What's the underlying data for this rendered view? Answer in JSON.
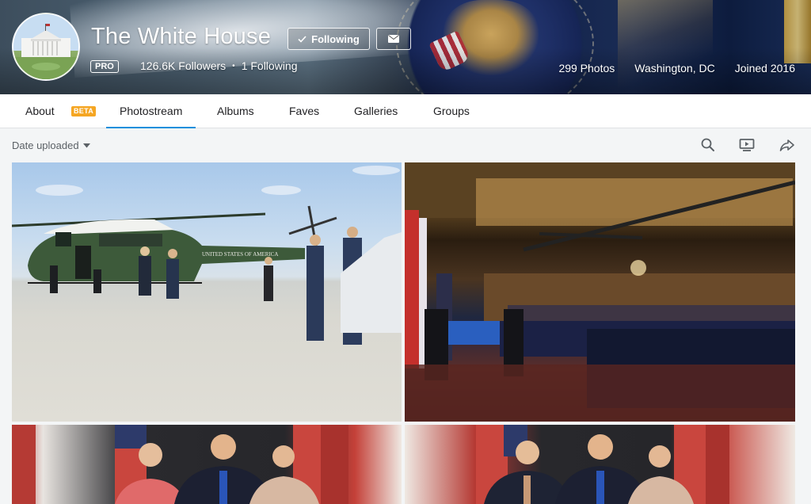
{
  "profile": {
    "name": "The White House",
    "follow_label": "Following",
    "pro_label": "PRO",
    "followers": "126.6K Followers",
    "following": "1 Following",
    "photos": "299 Photos",
    "location": "Washington, DC",
    "joined": "Joined 2016"
  },
  "tabs": {
    "about": "About",
    "beta": "BETA",
    "photostream": "Photostream",
    "albums": "Albums",
    "faves": "Faves",
    "galleries": "Galleries",
    "groups": "Groups",
    "active": "Photostream"
  },
  "toolbar": {
    "sort_label": "Date uploaded",
    "icons": [
      "search-icon",
      "slideshow-icon",
      "share-icon"
    ]
  },
  "photos": [
    {
      "name": "photo-helicopter"
    },
    {
      "name": "photo-ballroom"
    },
    {
      "name": "photo-portrait-1"
    },
    {
      "name": "photo-portrait-2"
    }
  ],
  "colors": {
    "accent": "#128fdc",
    "beta": "#f5a623",
    "nav_bg": "#ffffff",
    "page_bg": "#f3f5f6"
  }
}
